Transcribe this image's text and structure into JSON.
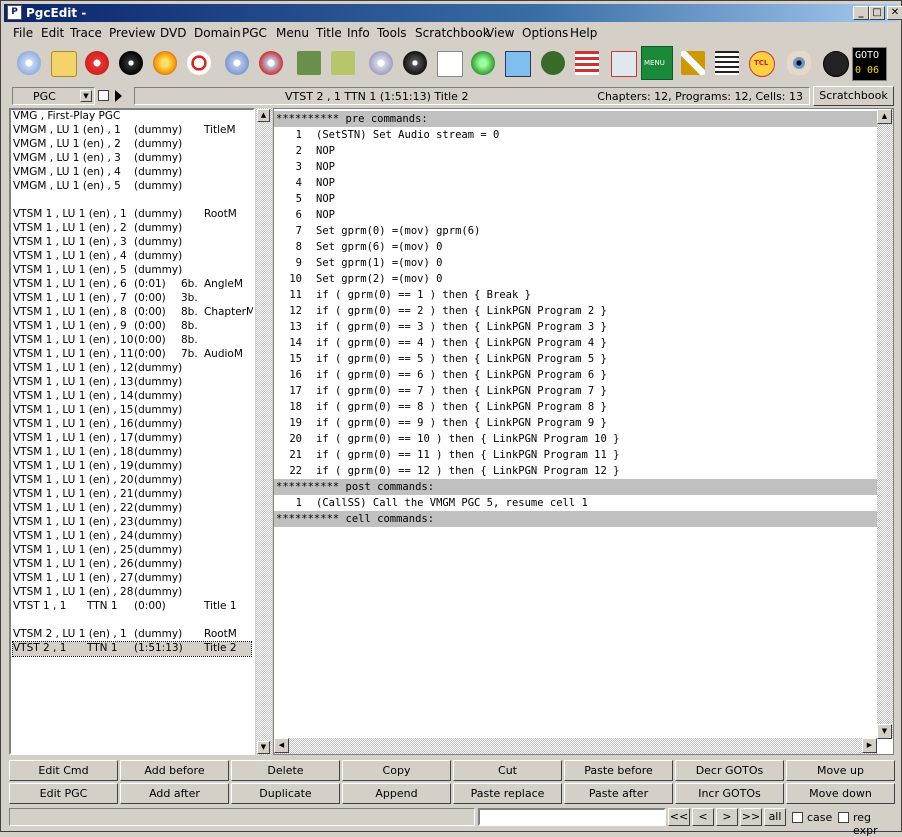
{
  "window": {
    "title": "PgcEdit -",
    "min": "_",
    "max": "□",
    "close": "✕"
  },
  "menu": [
    "File",
    "Edit",
    "Trace",
    "Preview",
    "DVD",
    "Domain",
    "PGC",
    "Menu",
    "Title",
    "Info",
    "Tools",
    "Scratchbook",
    "View",
    "Options",
    "Help"
  ],
  "toolbar": {
    "icons": [
      "open-disc-icon",
      "open-folder-icon",
      "trace-disc-icon",
      "new-disc-icon",
      "burn-icon",
      "find-icon",
      "disc-pair-icon",
      "disc-pair-red-icon",
      "bookmark-icon",
      "bookmark-add-icon",
      "check-disc-icon",
      "tcl-disc-icon",
      "copy-icon",
      "globe-icon",
      "preview-icon",
      "chameleon-icon",
      "list-icon",
      "grid-remove-icon",
      "menu-icon",
      "link-icon",
      "number-search-icon",
      "tcl-icon",
      "eye-icon",
      "navigate-icon"
    ],
    "menu_label": "MENU",
    "tcl_label": "TCL",
    "goto_label": "GOTO",
    "goto_value": "0  06"
  },
  "pgc_select": "PGC",
  "info": {
    "current": "VTST 2 , 1    TTN 1  (1:51:13)  Title 2",
    "summary": "Chapters: 12,  Programs: 12,  Cells: 13"
  },
  "scratchbook_button": "Scratchbook",
  "tree": [
    {
      "a": "VMG , First-Play PGC",
      "b": "",
      "c": "",
      "d": ""
    },
    {
      "a": "VMGM , LU 1 (en) , 1",
      "b": "(dummy)",
      "c": "",
      "d": "TitleM"
    },
    {
      "a": "VMGM , LU 1 (en) , 2",
      "b": "(dummy)",
      "c": "",
      "d": ""
    },
    {
      "a": "VMGM , LU 1 (en) , 3",
      "b": "(dummy)",
      "c": "",
      "d": ""
    },
    {
      "a": "VMGM , LU 1 (en) , 4",
      "b": "(dummy)",
      "c": "",
      "d": ""
    },
    {
      "a": "VMGM , LU 1 (en) , 5",
      "b": "(dummy)",
      "c": "",
      "d": ""
    },
    {
      "a": "",
      "b": "",
      "c": "",
      "d": ""
    },
    {
      "a": "VTSM 1 , LU 1 (en) , 1",
      "b": "(dummy)",
      "c": "",
      "d": "RootM"
    },
    {
      "a": "VTSM 1 , LU 1 (en) , 2",
      "b": "(dummy)",
      "c": "",
      "d": ""
    },
    {
      "a": "VTSM 1 , LU 1 (en) , 3",
      "b": "(dummy)",
      "c": "",
      "d": ""
    },
    {
      "a": "VTSM 1 , LU 1 (en) , 4",
      "b": "(dummy)",
      "c": "",
      "d": ""
    },
    {
      "a": "VTSM 1 , LU 1 (en) , 5",
      "b": "(dummy)",
      "c": "",
      "d": ""
    },
    {
      "a": "VTSM 1 , LU 1 (en) , 6",
      "b": "(0:01)",
      "c": "6b.",
      "d": "AngleM"
    },
    {
      "a": "VTSM 1 , LU 1 (en) , 7",
      "b": "(0:00)",
      "c": "3b.",
      "d": ""
    },
    {
      "a": "VTSM 1 , LU 1 (en) , 8",
      "b": "(0:00)",
      "c": "8b.",
      "d": "ChapterM"
    },
    {
      "a": "VTSM 1 , LU 1 (en) , 9",
      "b": "(0:00)",
      "c": "8b.",
      "d": ""
    },
    {
      "a": "VTSM 1 , LU 1 (en) , 10",
      "b": "(0:00)",
      "c": "8b.",
      "d": ""
    },
    {
      "a": "VTSM 1 , LU 1 (en) , 11",
      "b": "(0:00)",
      "c": "7b.",
      "d": "AudioM"
    },
    {
      "a": "VTSM 1 , LU 1 (en) , 12",
      "b": "(dummy)",
      "c": "",
      "d": ""
    },
    {
      "a": "VTSM 1 , LU 1 (en) , 13",
      "b": "(dummy)",
      "c": "",
      "d": ""
    },
    {
      "a": "VTSM 1 , LU 1 (en) , 14",
      "b": "(dummy)",
      "c": "",
      "d": ""
    },
    {
      "a": "VTSM 1 , LU 1 (en) , 15",
      "b": "(dummy)",
      "c": "",
      "d": ""
    },
    {
      "a": "VTSM 1 , LU 1 (en) , 16",
      "b": "(dummy)",
      "c": "",
      "d": ""
    },
    {
      "a": "VTSM 1 , LU 1 (en) , 17",
      "b": "(dummy)",
      "c": "",
      "d": ""
    },
    {
      "a": "VTSM 1 , LU 1 (en) , 18",
      "b": "(dummy)",
      "c": "",
      "d": ""
    },
    {
      "a": "VTSM 1 , LU 1 (en) , 19",
      "b": "(dummy)",
      "c": "",
      "d": ""
    },
    {
      "a": "VTSM 1 , LU 1 (en) , 20",
      "b": "(dummy)",
      "c": "",
      "d": ""
    },
    {
      "a": "VTSM 1 , LU 1 (en) , 21",
      "b": "(dummy)",
      "c": "",
      "d": ""
    },
    {
      "a": "VTSM 1 , LU 1 (en) , 22",
      "b": "(dummy)",
      "c": "",
      "d": ""
    },
    {
      "a": "VTSM 1 , LU 1 (en) , 23",
      "b": "(dummy)",
      "c": "",
      "d": ""
    },
    {
      "a": "VTSM 1 , LU 1 (en) , 24",
      "b": "(dummy)",
      "c": "",
      "d": ""
    },
    {
      "a": "VTSM 1 , LU 1 (en) , 25",
      "b": "(dummy)",
      "c": "",
      "d": ""
    },
    {
      "a": "VTSM 1 , LU 1 (en) , 26",
      "b": "(dummy)",
      "c": "",
      "d": ""
    },
    {
      "a": "VTSM 1 , LU 1 (en) , 27",
      "b": "(dummy)",
      "c": "",
      "d": ""
    },
    {
      "a": "VTSM 1 , LU 1 (en) , 28",
      "b": "(dummy)",
      "c": "",
      "d": ""
    },
    {
      "a": "VTST 1 , 1",
      "b": "TTN 1",
      "c": "(0:00)",
      "d": "Title 1"
    },
    {
      "a": "",
      "b": "",
      "c": "",
      "d": ""
    },
    {
      "a": "VTSM 2 , LU 1 (en) , 1",
      "b": "(dummy)",
      "c": "",
      "d": "RootM"
    },
    {
      "a": "VTST 2 , 1",
      "b": "TTN 1",
      "c": "(1:51:13)",
      "d": "Title 2",
      "selected": true
    }
  ],
  "code": [
    {
      "hdr": "********** pre commands:"
    },
    {
      "n": "1",
      "t": "(SetSTN) Set Audio stream = 0"
    },
    {
      "n": "2",
      "t": "NOP"
    },
    {
      "n": "3",
      "t": "NOP"
    },
    {
      "n": "4",
      "t": "NOP"
    },
    {
      "n": "5",
      "t": "NOP"
    },
    {
      "n": "6",
      "t": "NOP"
    },
    {
      "n": "7",
      "t": "Set gprm(0) =(mov) gprm(6)"
    },
    {
      "n": "8",
      "t": "Set gprm(6) =(mov) 0"
    },
    {
      "n": "9",
      "t": "Set gprm(1) =(mov) 0"
    },
    {
      "n": "10",
      "t": "Set gprm(2) =(mov) 0"
    },
    {
      "n": "11",
      "t": "if ( gprm(0) == 1 ) then { Break }"
    },
    {
      "n": "12",
      "t": "if ( gprm(0) == 2 ) then { LinkPGN Program 2 }"
    },
    {
      "n": "13",
      "t": "if ( gprm(0) == 3 ) then { LinkPGN Program 3 }"
    },
    {
      "n": "14",
      "t": "if ( gprm(0) == 4 ) then { LinkPGN Program 4 }"
    },
    {
      "n": "15",
      "t": "if ( gprm(0) == 5 ) then { LinkPGN Program 5 }"
    },
    {
      "n": "16",
      "t": "if ( gprm(0) == 6 ) then { LinkPGN Program 6 }"
    },
    {
      "n": "17",
      "t": "if ( gprm(0) == 7 ) then { LinkPGN Program 7 }"
    },
    {
      "n": "18",
      "t": "if ( gprm(0) == 8 ) then { LinkPGN Program 8 }"
    },
    {
      "n": "19",
      "t": "if ( gprm(0) == 9 ) then { LinkPGN Program 9 }"
    },
    {
      "n": "20",
      "t": "if ( gprm(0) == 10 ) then { LinkPGN Program 10 }"
    },
    {
      "n": "21",
      "t": "if ( gprm(0) == 11 ) then { LinkPGN Program 11 }"
    },
    {
      "n": "22",
      "t": "if ( gprm(0) == 12 ) then { LinkPGN Program 12 }"
    },
    {
      "hdr": "********** post commands:"
    },
    {
      "n": "1",
      "t": "(CallSS) Call the VMGM PGC 5, resume cell 1"
    },
    {
      "hdr": "********** cell commands:"
    }
  ],
  "buttons_row1": [
    "Edit Cmd",
    "Add before",
    "Delete",
    "Copy",
    "Cut",
    "Paste before",
    "Decr GOTOs",
    "Move up"
  ],
  "buttons_row2": [
    "Edit PGC",
    "Add after",
    "Duplicate",
    "Append",
    "Paste replace",
    "Paste after",
    "Incr GOTOs",
    "Move down"
  ],
  "nav": [
    "<<",
    "<",
    ">",
    ">>",
    "all"
  ],
  "search_opts": {
    "case": "case",
    "regexpr": "reg expr"
  }
}
